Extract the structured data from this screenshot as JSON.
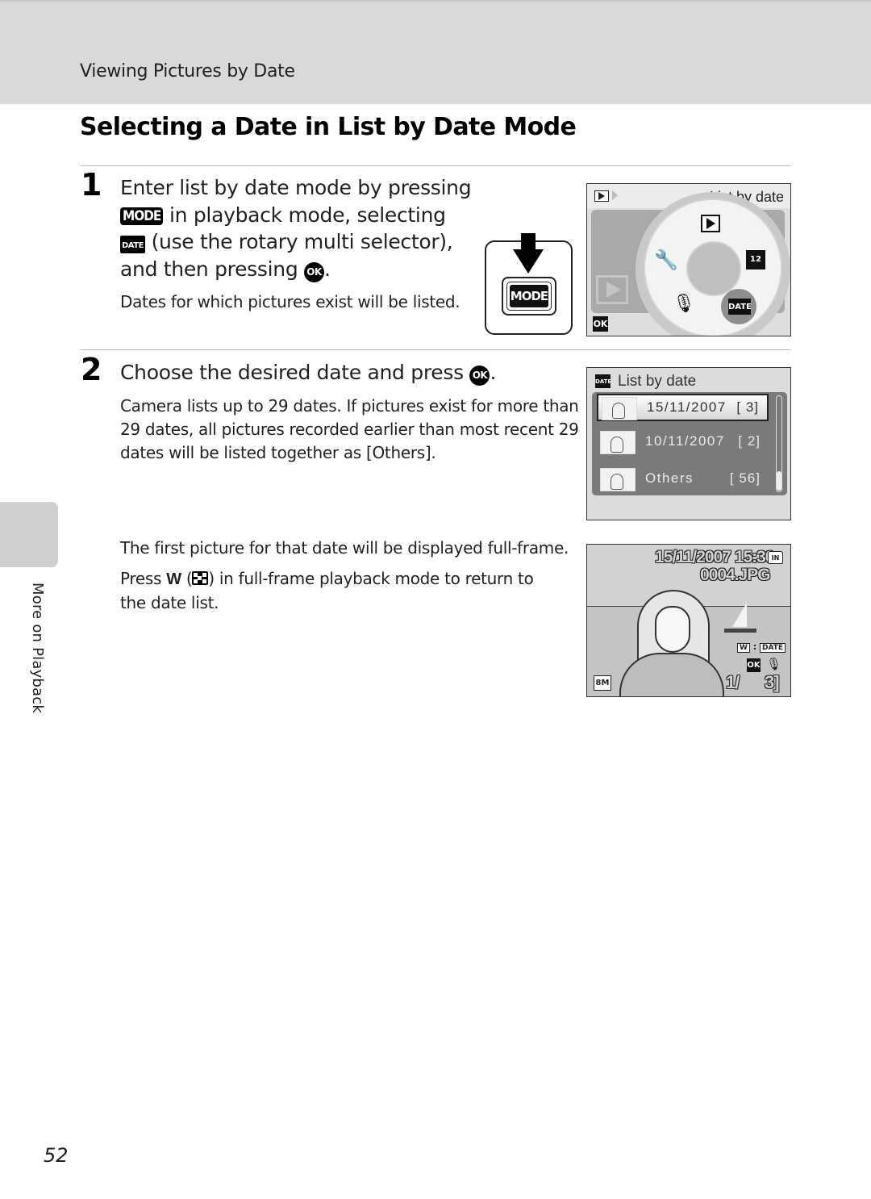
{
  "header": {
    "section_title": "Viewing Pictures by Date"
  },
  "page_title": "Selecting a Date in List by Date Mode",
  "steps": [
    {
      "number": "1",
      "instruction_lines": [
        "Enter list by date mode by pressing",
        " in playback mode, selecting",
        " (use the rotary multi selector),",
        "and then pressing "
      ],
      "instruction_end": ".",
      "note": "Dates for which pictures exist will be listed."
    },
    {
      "number": "2",
      "instruction": "Choose the desired date and press ",
      "instruction_end": ".",
      "note_lines": [
        "Camera lists up to 29 dates. If pictures exist for more than",
        "29 dates, all pictures recorded earlier than most recent 29",
        "dates will be listed together as [Others]."
      ],
      "note2": "The first picture for that date will be displayed full-frame.",
      "note3_pre": "Press ",
      "note3_key": "W",
      "note3_open": " (",
      "note3_mid": ") in full-frame playback mode to return to",
      "note3_line2": "the date list."
    }
  ],
  "icons": {
    "mode_label": "MODE",
    "date_label": "DATE",
    "ok_label": "OK",
    "in_label": "IN",
    "resolution_label": "8M"
  },
  "screen_mode_menu": {
    "title": "List by date",
    "ok_label": "OK",
    "calendar_label": "12"
  },
  "screen_date_list": {
    "title": "List by date",
    "rows": [
      {
        "date": "15/11/2007",
        "count": "[    3]",
        "selected": true
      },
      {
        "date": "10/11/2007",
        "count": "[    2]",
        "selected": false
      },
      {
        "date": "Others",
        "count": "[  56]",
        "selected": false
      }
    ]
  },
  "screen_full_frame": {
    "datetime": "15/11/2007 15:30",
    "filename": "0004.JPG",
    "frame_current": "1/",
    "frame_total": "3]",
    "frame_open": "[",
    "separator": ":"
  },
  "side_tab": {
    "label": "More on Playback"
  },
  "page_number": "52"
}
